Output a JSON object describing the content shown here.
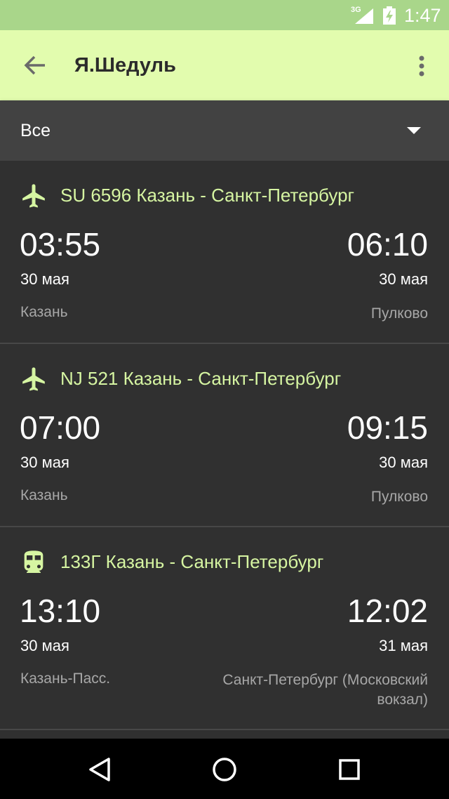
{
  "status_bar": {
    "network": "3G",
    "time": "1:47",
    "signal_icon": "signal-icon",
    "battery_icon": "battery-charging-icon"
  },
  "app_bar": {
    "title": "Я.Шедуль",
    "back_icon": "arrow-back-icon",
    "menu_icon": "more-vert-icon",
    "background": "#e2fcae"
  },
  "filter": {
    "selected": "Все",
    "dropdown_icon": "dropdown-arrow-icon"
  },
  "trips": [
    {
      "type": "plane",
      "icon": "airplane-icon",
      "title": "SU 6596 Казань - Санкт-Петербург",
      "departure_time": "03:55",
      "arrival_time": "06:10",
      "departure_date": "30 мая",
      "arrival_date": "30 мая",
      "departure_place": "Казань",
      "arrival_place": "Пулково"
    },
    {
      "type": "plane",
      "icon": "airplane-icon",
      "title": "NJ 521 Казань - Санкт-Петербург",
      "departure_time": "07:00",
      "arrival_time": "09:15",
      "departure_date": "30 мая",
      "arrival_date": "30 мая",
      "departure_place": "Казань",
      "arrival_place": "Пулково"
    },
    {
      "type": "train",
      "icon": "train-icon",
      "title": "133Г Казань - Санкт-Петербург",
      "departure_time": "13:10",
      "arrival_time": "12:02",
      "departure_date": "30 мая",
      "arrival_date": "31 мая",
      "departure_place": "Казань-Пасс.",
      "arrival_place": "Санкт-Петербург (Московский вокзал)"
    }
  ],
  "colors": {
    "accent": "#d6f5a2",
    "background": "#303030",
    "status_bar": "#a9d68a"
  },
  "nav_bar": {
    "back_icon": "nav-back-icon",
    "home_icon": "nav-home-icon",
    "recents_icon": "nav-recents-icon"
  }
}
